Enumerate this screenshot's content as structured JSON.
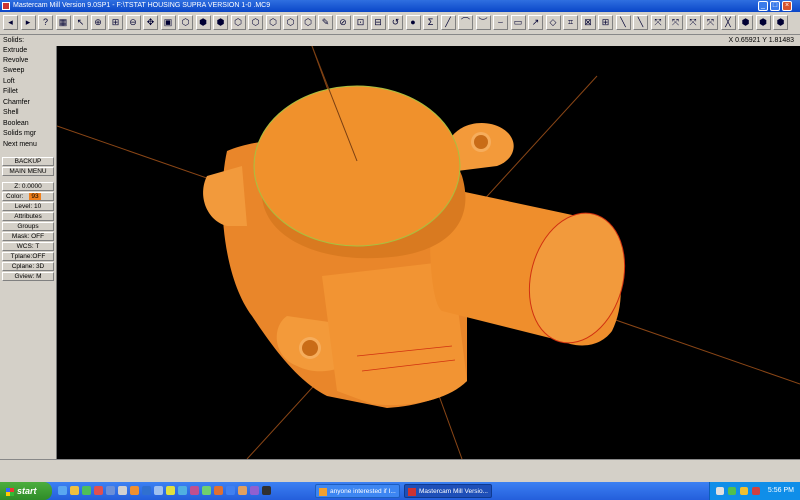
{
  "window": {
    "title": "Mastercam Mill Version 9.0SP1 - F:\\TSTAT HOUSING SUPRA VERSION 1-0 .MC9",
    "controls": [
      "_",
      "□",
      "×"
    ]
  },
  "toolbar": {
    "icons": [
      "back-arrow-icon",
      "forward-arrow-icon",
      "help-icon",
      "calculator-icon",
      "zoom-arrow-icon",
      "zoom-in-icon",
      "zoom-window-icon",
      "zoom-out-icon",
      "pan-icon",
      "repaint-icon",
      "solid-box-icon",
      "solid-cylinder-icon",
      "solid-sphere-icon",
      "view-front-icon",
      "view-top-icon",
      "view-side-icon",
      "view-iso-icon",
      "view-3d-icon",
      "shade-icon",
      "no-entry-icon",
      "analyze-icon",
      "transform-icon",
      "undo-icon",
      "sphere-icon",
      "sigma-icon",
      "line-icon",
      "arc-icon",
      "curve-icon",
      "spline-icon",
      "rectangle-icon",
      "arrow-icon",
      "chamfer-icon",
      "trim-icon",
      "break-icon",
      "extend-icon",
      "divide-icon",
      "xform-icon",
      "mirror-icon",
      "rotate-icon",
      "scale-icon",
      "nurbs-icon",
      "surface-icon",
      "solid-shell-icon",
      "fillet-surface-icon",
      "loft-icon"
    ],
    "glyphs": [
      "◂",
      "▸",
      "?",
      "▦",
      "↖",
      "⊕",
      "⊞",
      "⊖",
      "✥",
      "▣",
      "⬡",
      "⬢",
      "⬢",
      "⬡",
      "⬡",
      "⬡",
      "⬡",
      "⬡",
      "✎",
      "⊘",
      "⊡",
      "⊟",
      "↺",
      "●",
      "Σ",
      "╱",
      "⌒",
      "︶",
      "⌣",
      "▭",
      "↗",
      "◇",
      "⌗",
      "⊠",
      "⊞",
      "╲",
      "╲",
      "⤧",
      "⤧",
      "⤧",
      "⤧",
      "╳",
      "⬢",
      "⬢",
      "⬢"
    ]
  },
  "status": {
    "prompt": "Solids:",
    "coords": "X 0.65921  Y 1.81483"
  },
  "menu": {
    "items": [
      "Extrude",
      "Revolve",
      "Sweep",
      "Loft",
      "Fillet",
      "Chamfer",
      "Shell",
      "Boolean",
      "Solids mgr",
      "Next menu"
    ],
    "backup": "BACKUP",
    "main_menu": "MAIN MENU",
    "z": "Z: 0.0000",
    "color_label": "Color:",
    "color_value": "93",
    "level": "Level: 10",
    "attributes": "Attributes",
    "groups": "Groups",
    "mask": "Mask:  OFF",
    "wcs": "WCS:   T",
    "tplane": "Tplane:OFF",
    "cplane": "Cplane: 3D",
    "gview": "Gview:   M"
  },
  "colors": {
    "solid": "#f0912c",
    "solid_shadow": "#c96c17",
    "solid_highlight": "#f7a545",
    "axis": "#7a3f12",
    "edge": "#d03010"
  },
  "taskbar": {
    "start": "start",
    "tasks": [
      {
        "label": "anyone interested if I...",
        "active": false
      },
      {
        "label": "Mastercam Mill Versio...",
        "active": true
      }
    ],
    "clock": "5:56 PM"
  }
}
